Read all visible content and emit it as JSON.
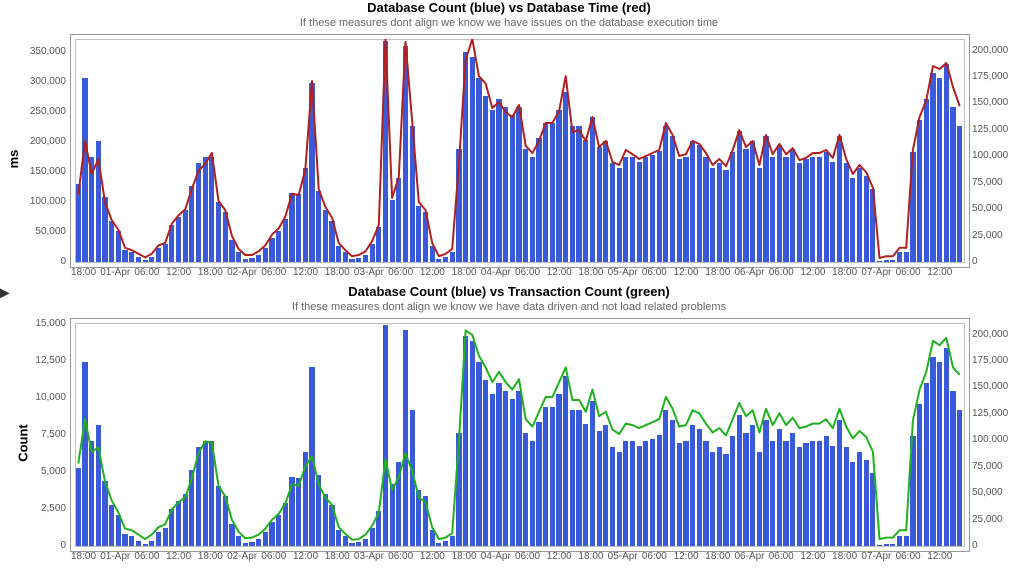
{
  "chart_data": [
    {
      "type": "bar+line",
      "title": "Database Count (blue) vs Database Time (red)",
      "subtitle": "If these measures dont align we know we have issues on the database execution time",
      "ylabel": "ms",
      "left_axis": {
        "min": 0,
        "max": 370000,
        "ticks": [
          0,
          50000,
          100000,
          150000,
          200000,
          250000,
          300000,
          350000
        ],
        "labels": [
          "0",
          "50,000",
          "100,000",
          "150,000",
          "200,000",
          "250,000",
          "300,000",
          "350,000"
        ]
      },
      "right_axis": {
        "min": 0,
        "max": 210000,
        "ticks": [
          0,
          25000,
          50000,
          75000,
          100000,
          125000,
          150000,
          175000,
          200000
        ],
        "labels": [
          "0",
          "25,000",
          "50,000",
          "75,000",
          "100,000",
          "125,000",
          "150,000",
          "175,000",
          "200,000"
        ]
      },
      "x_ticks": [
        "18:00",
        "01-Apr",
        "06:00",
        "12:00",
        "18:00",
        "02-Apr",
        "06:00",
        "12:00",
        "18:00",
        "03-Apr",
        "06:00",
        "12:00",
        "18:00",
        "04-Apr",
        "06:00",
        "12:00",
        "18:00",
        "05-Apr",
        "06:00",
        "12:00",
        "18:00",
        "06-Apr",
        "06:00",
        "12:00",
        "18:00",
        "07-Apr",
        "06:00",
        "12:00"
      ],
      "bars_right": [
        75000,
        175000,
        100000,
        115000,
        62000,
        40000,
        30000,
        12000,
        10000,
        6000,
        3000,
        6000,
        14000,
        18000,
        36000,
        44000,
        50000,
        73000,
        95000,
        100000,
        100000,
        58000,
        48000,
        22000,
        10000,
        4000,
        5000,
        8000,
        14000,
        24000,
        30000,
        42000,
        66000,
        65000,
        90000,
        170000,
        68000,
        50000,
        40000,
        16000,
        10000,
        4000,
        5000,
        8000,
        18000,
        34000,
        210000,
        60000,
        80000,
        205000,
        130000,
        54000,
        48000,
        16000,
        4000,
        6000,
        10000,
        108000,
        200000,
        195000,
        175000,
        158000,
        145000,
        155000,
        148000,
        140000,
        148000,
        108000,
        100000,
        118000,
        132000,
        132000,
        145000,
        162000,
        130000,
        130000,
        116000,
        138000,
        110000,
        115000,
        95000,
        90000,
        100000,
        100000,
        96000,
        100000,
        102000,
        106000,
        130000,
        120000,
        98000,
        100000,
        115000,
        112000,
        100000,
        90000,
        95000,
        88000,
        105000,
        125000,
        108000,
        115000,
        90000,
        120000,
        100000,
        112000,
        100000,
        108000,
        95000,
        98000,
        100000,
        100000,
        105000,
        96000,
        120000,
        95000,
        80000,
        90000,
        82000,
        70000,
        2000,
        3000,
        3000,
        10000,
        10000,
        105000,
        135000,
        155000,
        180000,
        175000,
        188000,
        148000,
        130000
      ],
      "line_left": [
        110000,
        200000,
        145000,
        170000,
        98000,
        68000,
        52000,
        22000,
        18000,
        12000,
        6000,
        12000,
        26000,
        30000,
        62000,
        76000,
        86000,
        120000,
        150000,
        162000,
        180000,
        100000,
        85000,
        42000,
        20000,
        10000,
        10000,
        16000,
        26000,
        44000,
        54000,
        74000,
        112000,
        110000,
        152000,
        300000,
        120000,
        90000,
        72000,
        30000,
        18000,
        8000,
        10000,
        16000,
        33000,
        60000,
        370000,
        105000,
        140000,
        365000,
        232000,
        98000,
        85000,
        30000,
        8000,
        12000,
        20000,
        162000,
        335000,
        370000,
        308000,
        296000,
        255000,
        265000,
        248000,
        240000,
        260000,
        192000,
        180000,
        200000,
        230000,
        230000,
        250000,
        308000,
        215000,
        218000,
        200000,
        240000,
        190000,
        200000,
        165000,
        160000,
        185000,
        178000,
        170000,
        175000,
        180000,
        185000,
        230000,
        210000,
        175000,
        178000,
        200000,
        195000,
        180000,
        160000,
        170000,
        158000,
        185000,
        218000,
        190000,
        200000,
        160000,
        210000,
        178000,
        195000,
        178000,
        188000,
        168000,
        172000,
        180000,
        180000,
        185000,
        172000,
        210000,
        170000,
        145000,
        160000,
        148000,
        122000,
        5000,
        8000,
        8000,
        22000,
        22000,
        185000,
        240000,
        268000,
        325000,
        320000,
        330000,
        290000,
        258000
      ],
      "line_color": "#b02020"
    },
    {
      "type": "bar+line",
      "title": "Database Count (blue) vs Transaction Count (green)",
      "subtitle": "If these measures dont align we know we have data driven and not load related problems",
      "ylabel": "Count",
      "left_axis": {
        "min": 0,
        "max": 15000,
        "ticks": [
          0,
          2500,
          5000,
          7500,
          10000,
          12500,
          15000
        ],
        "labels": [
          "0",
          "2,500",
          "5,000",
          "7,500",
          "10,000",
          "12,500",
          "15,000"
        ]
      },
      "right_axis": {
        "min": 0,
        "max": 210000,
        "ticks": [
          0,
          25000,
          50000,
          75000,
          100000,
          125000,
          150000,
          175000,
          200000
        ],
        "labels": [
          "0",
          "25,000",
          "50,000",
          "75,000",
          "100,000",
          "125,000",
          "150,000",
          "175,000",
          "200,000"
        ]
      },
      "x_ticks": [
        "18:00",
        "01-Apr",
        "06:00",
        "12:00",
        "18:00",
        "02-Apr",
        "06:00",
        "12:00",
        "18:00",
        "03-Apr",
        "06:00",
        "12:00",
        "18:00",
        "04-Apr",
        "06:00",
        "12:00",
        "18:00",
        "05-Apr",
        "06:00",
        "12:00",
        "18:00",
        "06-Apr",
        "06:00",
        "12:00",
        "18:00",
        "07-Apr",
        "06:00",
        "12:00"
      ],
      "bars_right": [
        75000,
        175000,
        100000,
        115000,
        62000,
        40000,
        30000,
        12000,
        10000,
        6000,
        3000,
        6000,
        14000,
        18000,
        36000,
        44000,
        50000,
        73000,
        95000,
        100000,
        100000,
        58000,
        48000,
        22000,
        10000,
        4000,
        5000,
        8000,
        14000,
        24000,
        30000,
        42000,
        66000,
        65000,
        90000,
        170000,
        68000,
        50000,
        40000,
        16000,
        10000,
        4000,
        5000,
        8000,
        18000,
        34000,
        210000,
        60000,
        80000,
        205000,
        130000,
        54000,
        48000,
        16000,
        4000,
        6000,
        10000,
        108000,
        200000,
        195000,
        175000,
        158000,
        145000,
        155000,
        148000,
        140000,
        148000,
        108000,
        100000,
        118000,
        132000,
        132000,
        145000,
        162000,
        130000,
        130000,
        116000,
        138000,
        110000,
        115000,
        95000,
        90000,
        100000,
        100000,
        96000,
        100000,
        102000,
        106000,
        130000,
        120000,
        98000,
        100000,
        115000,
        112000,
        100000,
        90000,
        95000,
        88000,
        105000,
        125000,
        108000,
        115000,
        90000,
        120000,
        100000,
        112000,
        100000,
        108000,
        95000,
        98000,
        100000,
        100000,
        105000,
        96000,
        120000,
        95000,
        80000,
        90000,
        82000,
        70000,
        2000,
        3000,
        3000,
        10000,
        10000,
        105000,
        135000,
        155000,
        180000,
        175000,
        188000,
        148000,
        130000
      ],
      "line_left": [
        5500,
        8500,
        6300,
        6600,
        4300,
        3000,
        2200,
        1100,
        1000,
        700,
        400,
        700,
        1200,
        1400,
        2400,
        2900,
        3200,
        4500,
        6200,
        7000,
        6900,
        4000,
        3300,
        1700,
        900,
        450,
        500,
        700,
        1100,
        1700,
        2100,
        2800,
        4100,
        4000,
        5300,
        6000,
        4100,
        3200,
        2700,
        1200,
        750,
        350,
        400,
        700,
        1300,
        2200,
        5800,
        3700,
        4600,
        6200,
        5000,
        3200,
        2900,
        1200,
        400,
        500,
        800,
        7000,
        14500,
        14200,
        12800,
        12000,
        11000,
        11700,
        11000,
        10500,
        11200,
        8500,
        8000,
        9000,
        10000,
        10000,
        11000,
        12000,
        9800,
        9800,
        9000,
        10500,
        8700,
        9000,
        7800,
        7500,
        8200,
        8100,
        7900,
        8100,
        8300,
        8500,
        10000,
        9200,
        8000,
        8100,
        9100,
        8900,
        8200,
        7600,
        7900,
        7400,
        8500,
        9600,
        8700,
        9100,
        7600,
        9200,
        8100,
        8900,
        8100,
        8600,
        7900,
        8000,
        8200,
        8200,
        8500,
        7900,
        9200,
        8000,
        7200,
        7700,
        7300,
        6300,
        400,
        500,
        500,
        1000,
        1000,
        8400,
        10500,
        11700,
        13800,
        13500,
        14000,
        12000,
        11500
      ],
      "line_color": "#20b020"
    }
  ]
}
